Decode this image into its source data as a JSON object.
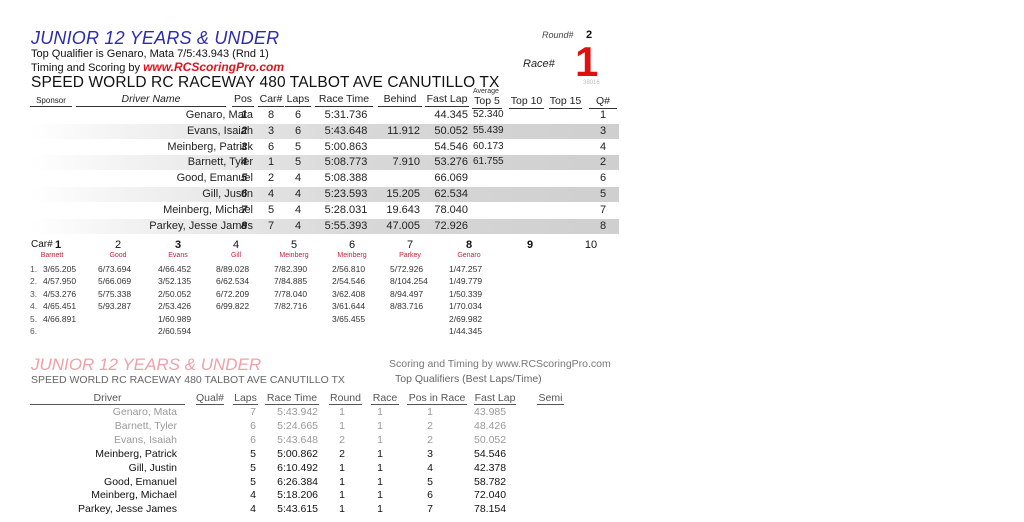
{
  "header": {
    "class_title": "JUNIOR 12 YEARS & UNDER",
    "top_qualifier": "Top Qualifier is Genaro, Mata 7/5:43.943 (Rnd 1)",
    "timing_prefix": "Timing and Scoring by ",
    "timing_brand": "www.RCScoringPro.com",
    "track": "SPEED WORLD RC RACEWAY 480 TALBOT AVE CANUTILLO TX",
    "round_label": "Round#",
    "round_value": "2",
    "race_label": "Race#",
    "race_value": "1",
    "small_code": "38016"
  },
  "results": {
    "columns": {
      "sponsor": "Sponsor",
      "driver": "Driver Name",
      "pos": "Pos",
      "car": "Car#",
      "laps": "Laps",
      "race_time": "Race Time",
      "behind": "Behind",
      "fast_lap": "Fast Lap",
      "average": "Average",
      "top5": "Top 5",
      "top10": "Top 10",
      "top15": "Top 15",
      "q": "Q#"
    },
    "rows": [
      {
        "driver": "Genaro, Mata",
        "pos": "1",
        "car": "8",
        "laps": "6",
        "time": "5:31.736",
        "behind": "",
        "fast": "44.345",
        "top5": "52.340",
        "q": "1"
      },
      {
        "driver": "Evans, Isaiah",
        "pos": "2",
        "car": "3",
        "laps": "6",
        "time": "5:43.648",
        "behind": "11.912",
        "fast": "50.052",
        "top5": "55.439",
        "q": "3"
      },
      {
        "driver": "Meinberg, Patrick",
        "pos": "3",
        "car": "6",
        "laps": "5",
        "time": "5:00.863",
        "behind": "",
        "fast": "54.546",
        "top5": "60.173",
        "q": "4"
      },
      {
        "driver": "Barnett, Tyler",
        "pos": "4",
        "car": "1",
        "laps": "5",
        "time": "5:08.773",
        "behind": "7.910",
        "fast": "53.276",
        "top5": "61.755",
        "q": "2"
      },
      {
        "driver": "Good, Emanuel",
        "pos": "5",
        "car": "2",
        "laps": "4",
        "time": "5:08.388",
        "behind": "",
        "fast": "66.069",
        "top5": "",
        "q": "6"
      },
      {
        "driver": "Gill, Justin",
        "pos": "6",
        "car": "4",
        "laps": "4",
        "time": "5:23.593",
        "behind": "15.205",
        "fast": "62.534",
        "top5": "",
        "q": "5"
      },
      {
        "driver": "Meinberg, Michael",
        "pos": "7",
        "car": "5",
        "laps": "4",
        "time": "5:28.031",
        "behind": "19.643",
        "fast": "78.040",
        "top5": "",
        "q": "7"
      },
      {
        "driver": "Parkey, Jesse James",
        "pos": "8",
        "car": "7",
        "laps": "4",
        "time": "5:55.393",
        "behind": "47.005",
        "fast": "72.926",
        "top5": "",
        "q": "8"
      }
    ]
  },
  "lap_chart": {
    "car_label": "Car#",
    "row_labels": [
      "1.",
      "2.",
      "3.",
      "4.",
      "5.",
      "6."
    ],
    "cars": [
      {
        "num": "1",
        "name": "Barnett",
        "laps": [
          "3/65.205",
          "4/57.950",
          "4/53.276",
          "4/65.451",
          "4/66.891"
        ]
      },
      {
        "num": "2",
        "name": "Good",
        "laps": [
          "6/73.694",
          "5/66.069",
          "5/75.338",
          "5/93.287"
        ]
      },
      {
        "num": "3",
        "name": "Evans",
        "laps": [
          "4/66.452",
          "3/52.135",
          "2/50.052",
          "2/53.426",
          "1/60.989",
          "2/60.594"
        ]
      },
      {
        "num": "4",
        "name": "Gill",
        "laps": [
          "8/89.028",
          "6/62.534",
          "6/72.209",
          "6/99.822"
        ]
      },
      {
        "num": "5",
        "name": "Meinberg",
        "laps": [
          "7/82.390",
          "7/84.885",
          "7/78.040",
          "7/82.716"
        ]
      },
      {
        "num": "6",
        "name": "Meinberg",
        "laps": [
          "2/56.810",
          "2/54.546",
          "3/62.408",
          "3/61.644",
          "3/65.455"
        ]
      },
      {
        "num": "7",
        "name": "Parkey",
        "laps": [
          "5/72.926",
          "8/104.254",
          "8/94.497",
          "8/83.716"
        ]
      },
      {
        "num": "8",
        "name": "Genaro",
        "laps": [
          "1/47.257",
          "1/49.779",
          "1/50.339",
          "1/70.034",
          "2/69.982",
          "1/44.345"
        ]
      },
      {
        "num": "9",
        "name": "",
        "laps": []
      },
      {
        "num": "10",
        "name": "",
        "laps": []
      }
    ]
  },
  "qualifiers": {
    "class_title": "JUNIOR 12 YEARS & UNDER",
    "track": "SPEED WORLD RC RACEWAY 480 TALBOT AVE CANUTILLO TX",
    "scoring": "Scoring and Timing by www.RCScoringPro.com",
    "subtitle": "Top Qualifiers (Best Laps/Time)",
    "columns": {
      "driver": "Driver",
      "qual": "Qual#",
      "laps": "Laps",
      "race_time": "Race Time",
      "round": "Round",
      "race": "Race",
      "pos_in_race": "Pos in Race",
      "fast_lap": "Fast Lap",
      "semi": "Semi"
    },
    "rows": [
      {
        "driver": "Genaro, Mata",
        "laps": "7",
        "time": "5:43.942",
        "round": "1",
        "race": "1",
        "pos": "1",
        "fast": "43.985",
        "dim": true
      },
      {
        "driver": "Barnett, Tyler",
        "laps": "6",
        "time": "5:24.665",
        "round": "1",
        "race": "1",
        "pos": "2",
        "fast": "48.426",
        "dim": true
      },
      {
        "driver": "Evans, Isaiah",
        "laps": "6",
        "time": "5:43.648",
        "round": "2",
        "race": "1",
        "pos": "2",
        "fast": "50.052",
        "dim": true
      },
      {
        "driver": "Meinberg, Patrick",
        "laps": "5",
        "time": "5:00.862",
        "round": "2",
        "race": "1",
        "pos": "3",
        "fast": "54.546",
        "dim": false
      },
      {
        "driver": "Gill, Justin",
        "laps": "5",
        "time": "6:10.492",
        "round": "1",
        "race": "1",
        "pos": "4",
        "fast": "42.378",
        "dim": false
      },
      {
        "driver": "Good, Emanuel",
        "laps": "5",
        "time": "6:26.384",
        "round": "1",
        "race": "1",
        "pos": "5",
        "fast": "58.782",
        "dim": false
      },
      {
        "driver": "Meinberg, Michael",
        "laps": "4",
        "time": "5:18.206",
        "round": "1",
        "race": "1",
        "pos": "6",
        "fast": "72.040",
        "dim": false
      },
      {
        "driver": "Parkey, Jesse James",
        "laps": "4",
        "time": "5:43.615",
        "round": "1",
        "race": "1",
        "pos": "7",
        "fast": "78.154",
        "dim": false
      }
    ]
  }
}
